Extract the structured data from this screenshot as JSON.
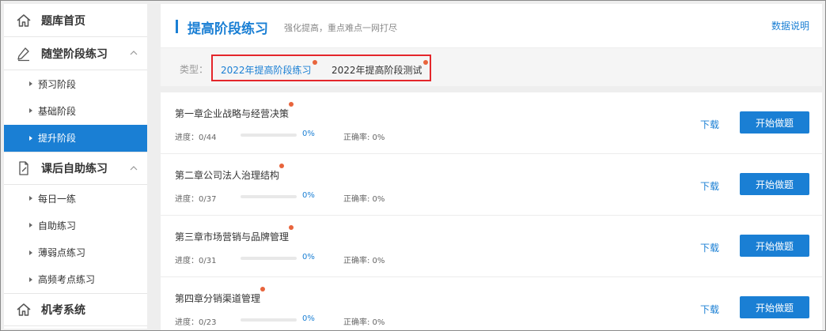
{
  "sidebar": {
    "home": {
      "label": "题库首页",
      "icon": "home-icon"
    },
    "groups": [
      {
        "label": "随堂阶段练习",
        "icon": "pencil-icon",
        "items": [
          {
            "label": "预习阶段",
            "active": false
          },
          {
            "label": "基础阶段",
            "active": false
          },
          {
            "label": "提升阶段",
            "active": true
          }
        ]
      },
      {
        "label": "课后自助练习",
        "icon": "document-edit-icon",
        "items": [
          {
            "label": "每日一练",
            "active": false
          },
          {
            "label": "自助练习",
            "active": false
          },
          {
            "label": "薄弱点练习",
            "active": false
          },
          {
            "label": "高频考点练习",
            "active": false
          }
        ]
      }
    ],
    "exam": {
      "label": "机考系统",
      "icon": "home-icon"
    }
  },
  "header": {
    "title": "提高阶段练习",
    "subtitle": "强化提高，重点难点一网打尽",
    "data_link": "数据说明"
  },
  "filter": {
    "type_label": "类型：",
    "tabs": [
      {
        "label": "2022年提高阶段练习",
        "active": true
      },
      {
        "label": "2022年提高阶段测试",
        "active": false
      }
    ]
  },
  "chapters": [
    {
      "title": "第一章企业战略与经营决策",
      "progress_label": "进度：0/44",
      "progress": 0,
      "progress_pct": "0%",
      "accuracy": "正确率: 0%",
      "download": "下载",
      "start": "开始做题"
    },
    {
      "title": "第二章公司法人治理结构",
      "progress_label": "进度：0/37",
      "progress": 0,
      "progress_pct": "0%",
      "accuracy": "正确率: 0%",
      "download": "下载",
      "start": "开始做题"
    },
    {
      "title": "第三章市场营销与品牌管理",
      "progress_label": "进度：0/31",
      "progress": 0,
      "progress_pct": "0%",
      "accuracy": "正确率: 0%",
      "download": "下载",
      "start": "开始做题"
    },
    {
      "title": "第四章分销渠道管理",
      "progress_label": "进度：0/23",
      "progress": 0,
      "progress_pct": "0%",
      "accuracy": "正确率: 0%",
      "download": "下载",
      "start": "开始做题"
    }
  ],
  "colors": {
    "accent": "#1a7fd4",
    "highlight_border": "#e4262b",
    "notification_dot": "#e8643c"
  }
}
